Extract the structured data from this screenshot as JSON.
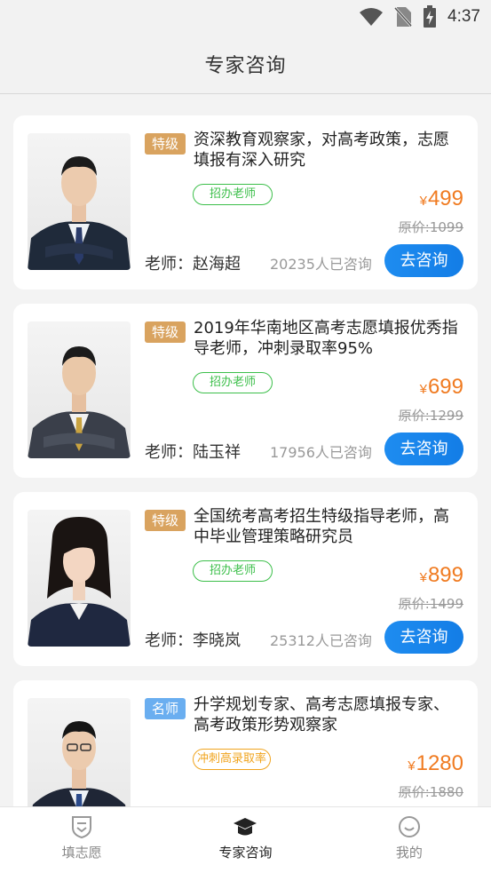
{
  "status_bar": {
    "time": "4:37"
  },
  "header": {
    "title": "专家咨询"
  },
  "experts": [
    {
      "badge": "特级",
      "badge_color": "#d9a35f",
      "description": "资深教育观察家，对高考政策，志愿填报有深入研究",
      "tag": "招办老师",
      "tag_color": "#3cbf4a",
      "currency": "¥",
      "price": "499",
      "original_price": "原价:1099",
      "teacher": "老师：赵海超",
      "consult_count": "20235人已咨询",
      "button": "去咨询"
    },
    {
      "badge": "特级",
      "badge_color": "#d9a35f",
      "description": "2019年华南地区高考志愿填报优秀指导老师，冲刺录取率95%",
      "tag": "招办老师",
      "tag_color": "#3cbf4a",
      "currency": "¥",
      "price": "699",
      "original_price": "原价:1299",
      "teacher": "老师：陆玉祥",
      "consult_count": "17956人已咨询",
      "button": "去咨询"
    },
    {
      "badge": "特级",
      "badge_color": "#d9a35f",
      "description": "全国统考高考招生特级指导老师，高中毕业管理策略研究员",
      "tag": "招办老师",
      "tag_color": "#3cbf4a",
      "currency": "¥",
      "price": "899",
      "original_price": "原价:1499",
      "teacher": "老师：李晓岚",
      "consult_count": "25312人已咨询",
      "button": "去咨询"
    },
    {
      "badge": "名师",
      "badge_color": "#6aaef0",
      "description": "升学规划专家、高考志愿填报专家、高考政策形势观察家",
      "tag": "冲刺高录取率",
      "tag_color": "#f0a41e",
      "currency": "¥",
      "price": "1280",
      "original_price": "原价:1880",
      "teacher": "",
      "consult_count": "",
      "button": ""
    }
  ],
  "tabs": [
    {
      "label": "填志愿",
      "icon": "shield-icon",
      "active": false
    },
    {
      "label": "专家咨询",
      "icon": "graduation-cap-icon",
      "active": true
    },
    {
      "label": "我的",
      "icon": "smiley-icon",
      "active": false
    }
  ],
  "colors": {
    "accent_blue": "#1e8cf0",
    "price_orange": "#f07b21"
  }
}
